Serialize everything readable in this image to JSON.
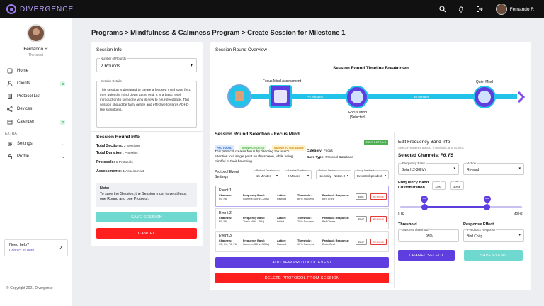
{
  "app": {
    "logo_text": "DIVERGENCE",
    "user_name": "Fernando R"
  },
  "sidebar": {
    "profile": {
      "name": "Fernando R",
      "role": "Therapist"
    },
    "items": [
      {
        "label": "Home",
        "icon": "home-icon",
        "badge": ""
      },
      {
        "label": "Clients",
        "icon": "user-icon",
        "badge": "8"
      },
      {
        "label": "Protocol List",
        "icon": "list-icon",
        "badge": ""
      },
      {
        "label": "Devices",
        "icon": "share-icon",
        "badge": ""
      },
      {
        "label": "Calender",
        "icon": "calendar-icon",
        "badge": "3"
      }
    ],
    "extra_label": "EXTRA",
    "extra_items": [
      {
        "label": "Settings",
        "icon": "gear-icon"
      },
      {
        "label": "Profile",
        "icon": "lock-icon"
      }
    ],
    "help": {
      "title": "Need help?",
      "link": "Contact us here"
    },
    "copyright": "© Copyright 2021 Divergence"
  },
  "breadcrumb": "Programs  > Mindfulness & Calmness Program > Create Session for Milestone 1",
  "session_info": {
    "title": "Session Info",
    "rounds_label": "Number of Rounds",
    "rounds_value": "2 Rounds",
    "details_label": "Session Details",
    "details_text": "This session is designed to create a focused mind state first, then quiet the mind down at the end. It is a basic level introduction to someone who is new to neurofeedback. This session should be fairly gentle and effective towards ADHD like symptoms.",
    "round_info_title": "Session Round Info",
    "total_sections_label": "Total Sections:",
    "total_sections_value": "2 Sections",
    "total_duration_label": "Total Duration :",
    "total_duration_value": "~ 8 Mins",
    "protocols_label": "Protocols:",
    "protocols_value": "1 Protocols",
    "assessments_label": "Assessments:",
    "assessments_value": "1 Assessment",
    "note_title": "Note:",
    "note_text": "To save the Session, the Session must have at least one Round and one Protocol.",
    "save_label": "SAVE SESSION",
    "cancel_label": "CANCEL"
  },
  "overview": {
    "title": "Session Round Overview",
    "timeline_title": "Session Round Timeline Breakdown",
    "nodes": [
      "Focus Mind Assessment",
      "Focus Mind\n(Selected)",
      "Quiet Mind"
    ],
    "durations": [
      "~2 Minutes",
      "10 Minutes"
    ]
  },
  "selection": {
    "title": "Session Round Selection  - Focus Mind",
    "tags": [
      "PROTOCOL",
      "NEWLY CREATED",
      "SAVING TO DATABASE"
    ],
    "edit_details": "EDIT DETAILS",
    "description": "This protocol creates focus by directing the user's attention to a single point on the screen, while being mindful of their breathing.",
    "category_label": "Category:",
    "category_value": "Focus",
    "save_type_label": "Save Type:",
    "save_type_value": "Protocol Database",
    "settings_label": "Protocol Event\nSettings",
    "selects": [
      {
        "label": "Protocol Duration",
        "value": "15 Minutes"
      },
      {
        "label": "Baseline Duration",
        "value": "2 Minutes"
      },
      {
        "label": "Protocol Device",
        "value": "Neurosity - Notion 3"
      },
      {
        "label": "Group Feedback",
        "value": "Event Independent"
      }
    ],
    "col_labels": {
      "channels": "Channels:",
      "band": "Frequency Band:",
      "action": "Action:",
      "threshold": "Threshold:",
      "feedback": "Feedback Response:"
    },
    "events": [
      {
        "name": "Event 1",
        "channels": "F5, F6",
        "band": "Gamma (40Hz -72Hz)",
        "action": "Reward",
        "threshold": "80% Success",
        "feedback": "Bird Chirp"
      },
      {
        "name": "Event 2",
        "channels": "F5, F6",
        "band": "Theta (4Hz - 7Hz)",
        "action": "Inhibit",
        "threshold": "75% Success",
        "feedback": "Bell Chime"
      },
      {
        "name": "Event 3",
        "channels": "C3, C4, F5, F6",
        "band": "Gamma (34Hz -72Hz)",
        "action": "Reward",
        "threshold": "90% Success",
        "feedback": "Drum Beat"
      }
    ],
    "edit_label": "EDIT",
    "remove_label": "REMOVE",
    "add_event_label": "ADD NEW PROTOCOL EVENT",
    "delete_label": "DELETE PROTOCOL FROM SESSION"
  },
  "edit_band": {
    "title": "Edit Frequency Band Info",
    "subtitle": "Select Frequency Bands, Thresholds, and Actions",
    "channels_label": "Selected Channels:",
    "channels_value": "F6, F5",
    "band_label": "Frequency Band",
    "band_value": "Beta (12-30Hz)",
    "action_label": "Action",
    "action_value": "Reward",
    "customization_label": "Frequency Band\nCustomization",
    "min_label": "Min",
    "min_value": "12Hz",
    "max_label": "Max",
    "max_value": "30Hz",
    "slider_min_label": "5 Hz",
    "slider_max_label": "40 Hz",
    "slider_min_hz": 5,
    "slider_max_hz": 40,
    "slider_low_hz": 12,
    "slider_high_hz": 30,
    "knob_low": "12Hz",
    "knob_high": "30Hz",
    "threshold_title": "Threshold",
    "threshold_label": "Success Threshold",
    "threshold_value": "95%",
    "response_title": "Response Effect",
    "response_label": "Feedback Response",
    "response_value": "Bird Chirp",
    "channel_select_label": "CHANEL SELECT",
    "save_event_label": "SAVE EVENT"
  },
  "colors": {
    "accent": "#5f3ee0",
    "teal": "#6fd8cf",
    "danger": "#ff1f1f",
    "timeline_cyan": "#22c3e8"
  }
}
